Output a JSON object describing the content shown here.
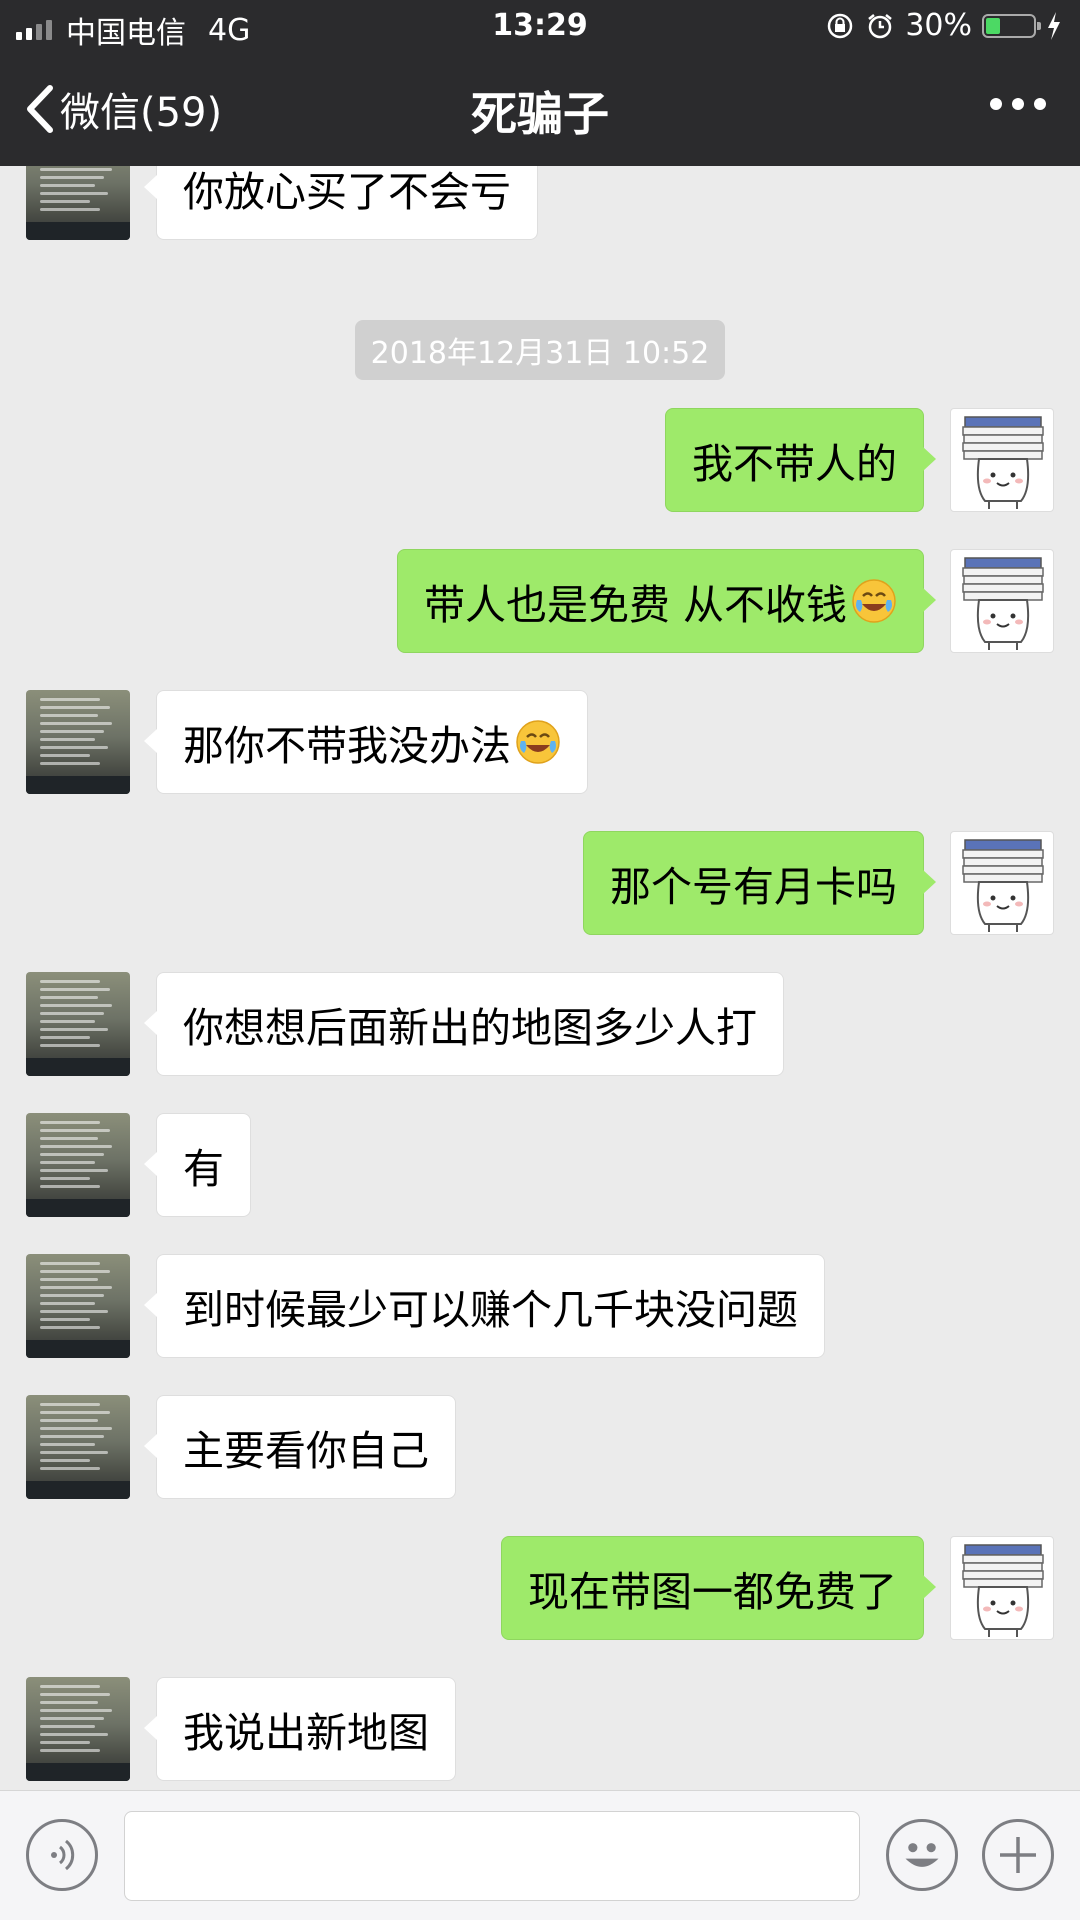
{
  "status_bar": {
    "carrier": "中国电信",
    "network": "4G",
    "time": "13:29",
    "battery": "30%",
    "battery_level": 0.3
  },
  "nav": {
    "back_label": "微信(59)",
    "title": "死骗子"
  },
  "timestamp": "2018年12月31日 10:52",
  "messages": [
    {
      "side": "in",
      "text": "你放心买了不会亏"
    },
    {
      "side": "out",
      "text": "我不带人的"
    },
    {
      "side": "out",
      "text": "带人也是免费 从不收钱",
      "emoji": "laughing-crying-emoji"
    },
    {
      "side": "in",
      "text": "那你不带我没办法",
      "emoji": "laughing-crying-emoji"
    },
    {
      "side": "out",
      "text": "那个号有月卡吗"
    },
    {
      "side": "in",
      "text": "你想想后面新出的地图多少人打"
    },
    {
      "side": "in",
      "text": "有"
    },
    {
      "side": "in",
      "text": "到时候最少可以赚个几千块没问题"
    },
    {
      "side": "in",
      "text": "主要看你自己"
    },
    {
      "side": "out",
      "text": "现在带图一都免费了"
    },
    {
      "side": "in",
      "text": "我说出新地图"
    }
  ],
  "input": {
    "placeholder": ""
  },
  "colors": {
    "header_bg": "#2b2b2d",
    "chat_bg": "#ebebeb",
    "outgoing_bubble": "#9eea6a",
    "incoming_bubble": "#ffffff",
    "battery_fill": "#4cd964"
  },
  "icons": {
    "voice": "voice-input-icon",
    "emoji": "emoji-smile-icon",
    "plus": "plus-icon"
  }
}
